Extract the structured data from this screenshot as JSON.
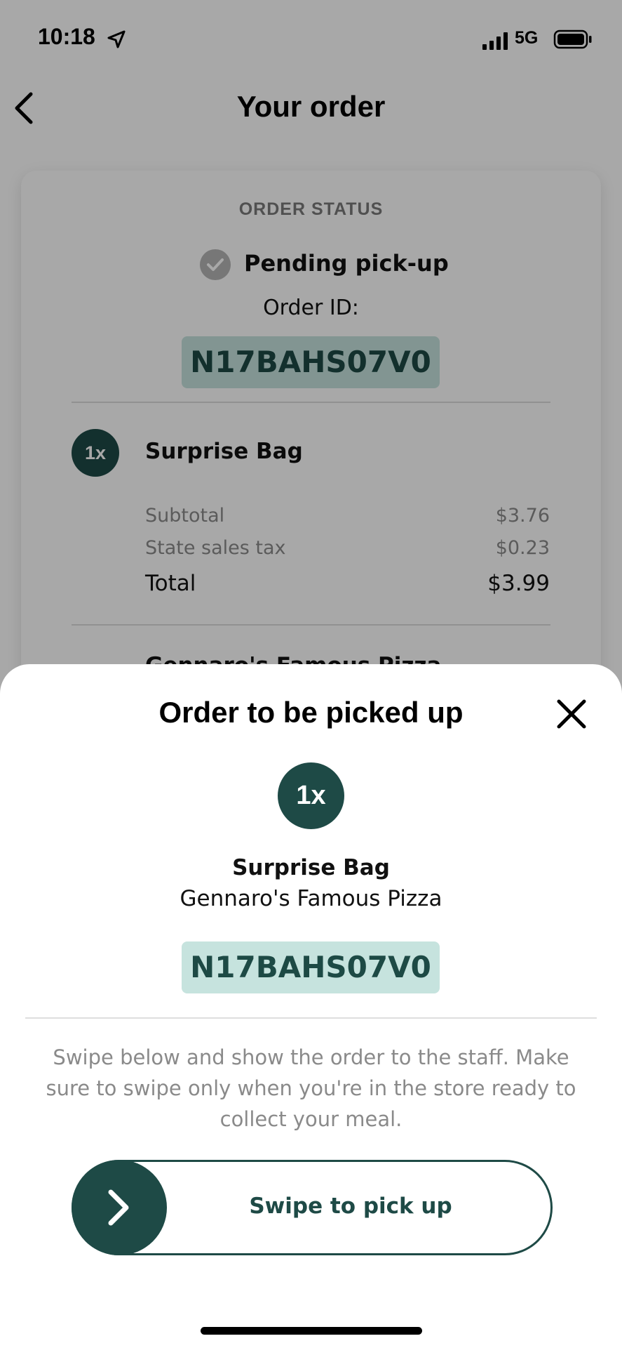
{
  "status_bar": {
    "time": "10:18",
    "network": "5G"
  },
  "header": {
    "title": "Your order"
  },
  "order_card": {
    "status_heading": "ORDER STATUS",
    "status": "Pending pick-up",
    "order_id_label": "Order ID:",
    "order_id": "N17BAHS07V0",
    "item": {
      "quantity": "1x",
      "name": "Surprise Bag"
    },
    "subtotal_label": "Subtotal",
    "subtotal": "$3.76",
    "tax_label": "State sales tax",
    "tax": "$0.23",
    "total_label": "Total",
    "total": "$3.99",
    "store_partial": "Gennaro's Famous Pizza"
  },
  "sheet": {
    "title": "Order to be picked up",
    "quantity": "1x",
    "item_name": "Surprise Bag",
    "store_name": "Gennaro's Famous Pizza",
    "order_id": "N17BAHS07V0",
    "instructions": "Swipe below and show the order to the staff. Make sure to swipe only when you're in the store ready to collect your meal.",
    "swipe_label": "Swipe to pick up"
  },
  "colors": {
    "brand_dark_green": "#1e4a46",
    "code_background": "#c6e3de",
    "code_text": "#1d4a45",
    "overlay": "rgba(0,0,0,0.34)"
  },
  "icons": {
    "location": "location-arrow-icon",
    "signal": "cellular-signal-icon",
    "battery": "battery-icon",
    "back": "chevron-left-icon",
    "status_check": "check-circle-icon",
    "close": "close-icon",
    "swipe": "chevron-right-icon"
  }
}
